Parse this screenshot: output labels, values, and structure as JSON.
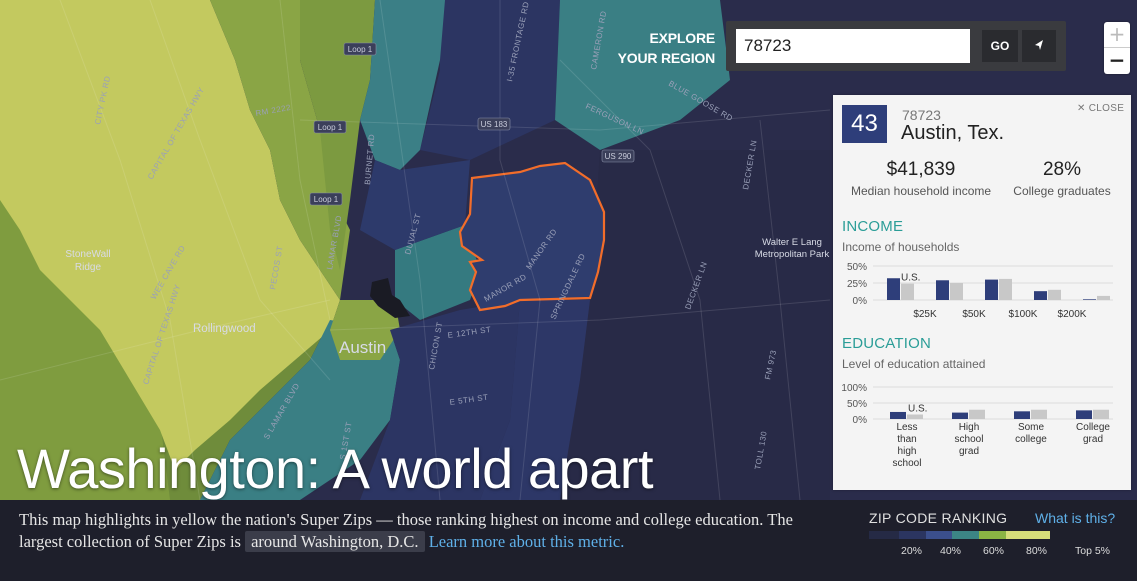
{
  "map": {
    "labels": {
      "stonewall_ridge": "StoneWall\nRidge",
      "rollingwood": "Rollingwood",
      "austin": "Austin",
      "walter_lang": "Walter E Lang\nMetropolitan Park"
    },
    "roads": [
      "CITY PK RD",
      "RM 2222",
      "CAPITAL OF TEXAS HWY",
      "PECOS ST",
      "LAMAR BLVD",
      "BURNET RD",
      "FERGUSON LN",
      "BLUE GOOSE RD",
      "I-35 FRONTAGE RD",
      "CAMERON RD",
      "DECKER LN",
      "MANOR RD",
      "SPRINGDALE RD",
      "E 12TH ST",
      "E 5TH ST",
      "CHICON ST",
      "DUVAL ST",
      "TOLL 130",
      "S LAMAR BLVD",
      "S 1ST ST",
      "WEE CAVE RD",
      "FM 973"
    ],
    "shields": [
      "Loop 1",
      "Loop 1",
      "Loop 1",
      "US 183",
      "US 290"
    ],
    "colors": {
      "yellow": "#c4cc61",
      "green": "#8ba444",
      "darkgreen": "#6d8b3a",
      "teal": "#3c8585",
      "darkteal": "#356f79",
      "blue": "#2f3d6e",
      "navy": "#262a4c",
      "highlight": "#f26d2a"
    }
  },
  "explore": {
    "label_line1": "EXPLORE",
    "label_line2": "YOUR REGION",
    "input_value": "78723",
    "go_label": "GO",
    "locate_icon": "location-arrow-icon"
  },
  "zoom": {
    "in_label": "+",
    "out_label": "−"
  },
  "panel": {
    "rank": "43",
    "zip": "78723",
    "city": "Austin, Tex.",
    "close_label": "✕ CLOSE",
    "income_value": "$41,839",
    "income_label": "Median household income",
    "college_value": "28%",
    "college_label": "College graduates",
    "income_section": {
      "title": "INCOME",
      "subtitle": "Income of households",
      "us_label": "U.S.",
      "y_ticks": [
        "50%",
        "25%",
        "0%"
      ],
      "x_ticks": [
        "$25K",
        "$50K",
        "$100K",
        "$200K"
      ],
      "local": [
        0.32,
        0.29,
        0.3,
        0.13,
        0.01
      ],
      "us": [
        0.24,
        0.25,
        0.31,
        0.15,
        0.06
      ]
    },
    "education_section": {
      "title": "EDUCATION",
      "subtitle": "Level of education attained",
      "us_label": "U.S.",
      "y_ticks": [
        "100%",
        "50%",
        "0%"
      ],
      "categories": [
        "Less\nthan\nhigh\nschool",
        "High\nschool\ngrad",
        "Some\ncollege",
        "College\ngrad"
      ],
      "local": [
        0.22,
        0.2,
        0.24,
        0.27
      ],
      "us": [
        0.14,
        0.29,
        0.29,
        0.29
      ]
    },
    "colors": {
      "local": "#2e3e7a",
      "us": "#c8c8c8"
    }
  },
  "title": "Washington: A world apart",
  "description": {
    "text_1": "This map highlights in yellow the nation's Super Zips — those ranking highest on income and college education. The largest collection of Super Zips is",
    "pill": "around Washington, D.C.",
    "link": "Learn more about this metric."
  },
  "legend": {
    "title": "ZIP CODE RANKING",
    "link": "What is this?",
    "ticks": [
      "20%",
      "40%",
      "60%",
      "80%",
      "Top 5%"
    ],
    "colors": [
      "#252a45",
      "#2b3560",
      "#3b4f8c",
      "#3c8585",
      "#8bb544",
      "#d6dd7a"
    ]
  }
}
